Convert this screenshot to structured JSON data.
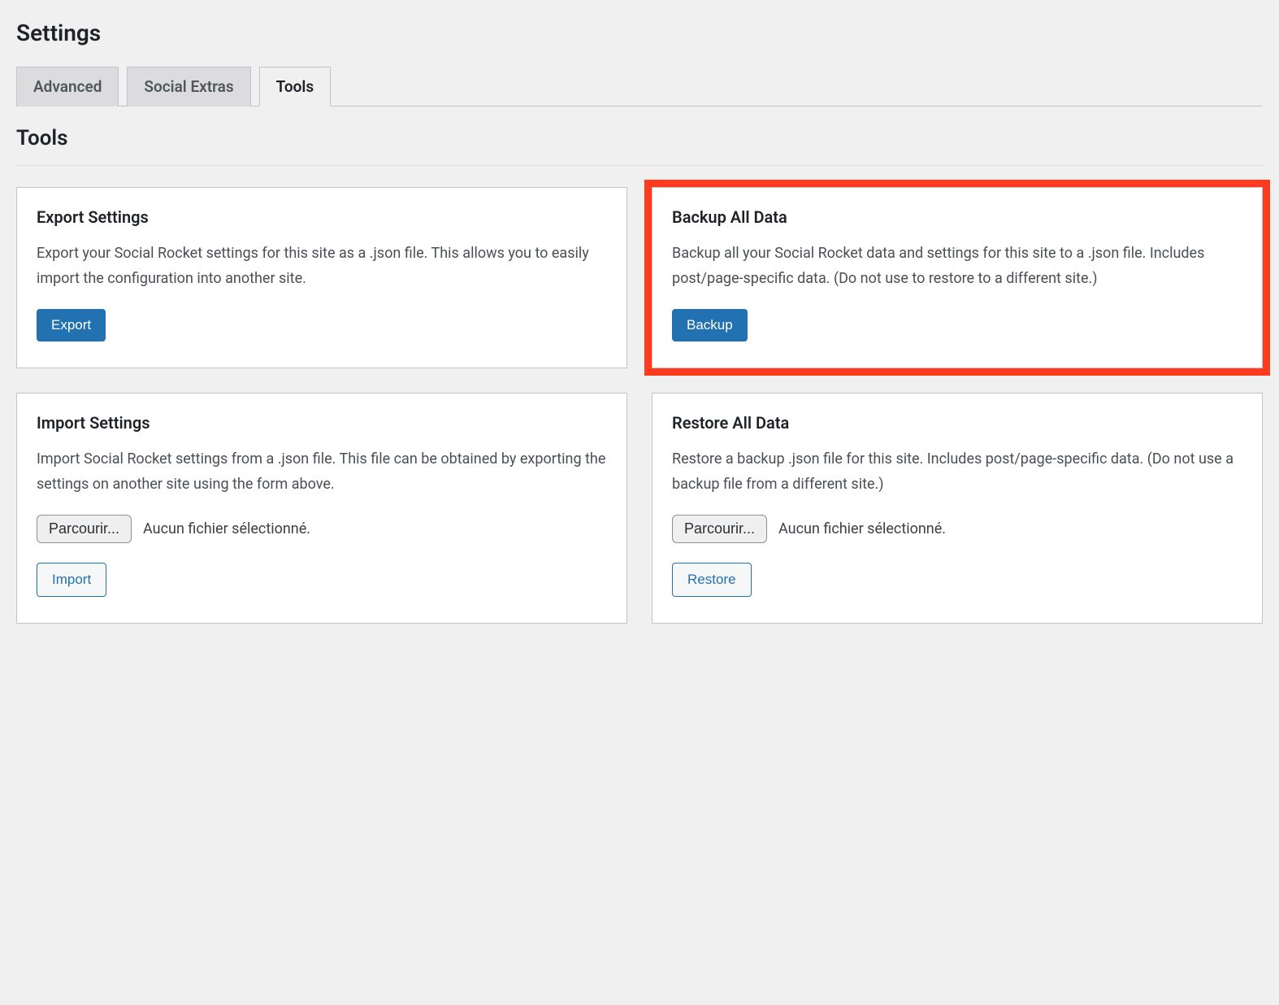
{
  "page": {
    "title": "Settings",
    "section": "Tools"
  },
  "tabs": [
    {
      "label": "Advanced",
      "active": false
    },
    {
      "label": "Social Extras",
      "active": false
    },
    {
      "label": "Tools",
      "active": true
    }
  ],
  "cards": {
    "export": {
      "title": "Export Settings",
      "text": "Export your Social Rocket settings for this site as a .json file. This allows you to easily import the configuration into another site.",
      "button": "Export"
    },
    "backup": {
      "title": "Backup All Data",
      "text": "Backup all your Social Rocket data and settings for this site to a .json file. Includes post/page-specific data. (Do not use to restore to a different site.)",
      "button": "Backup"
    },
    "import": {
      "title": "Import Settings",
      "text": "Import Social Rocket settings from a .json file. This file can be obtained by exporting the settings on another site using the form above.",
      "file_button": "Parcourir...",
      "file_status": "Aucun fichier sélectionné.",
      "button": "Import"
    },
    "restore": {
      "title": "Restore All Data",
      "text": "Restore a backup .json file for this site. Includes post/page-specific data. (Do not use a backup file from a different site.)",
      "file_button": "Parcourir...",
      "file_status": "Aucun fichier sélectionné.",
      "button": "Restore"
    }
  }
}
